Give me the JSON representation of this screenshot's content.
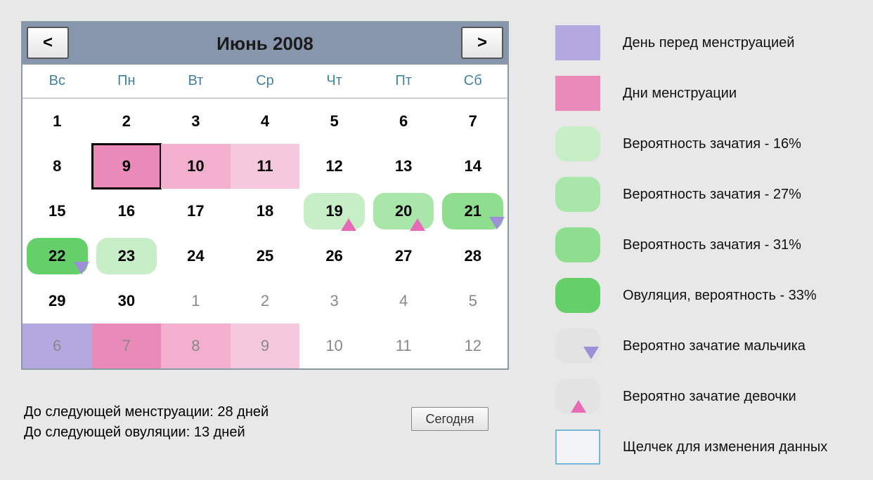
{
  "header": {
    "title": "Июнь 2008",
    "prev": "<",
    "next": ">"
  },
  "weekdays": [
    "Вс",
    "Пн",
    "Вт",
    "Ср",
    "Чт",
    "Пт",
    "Сб"
  ],
  "days": [
    {
      "n": "1"
    },
    {
      "n": "2"
    },
    {
      "n": "3"
    },
    {
      "n": "4"
    },
    {
      "n": "5"
    },
    {
      "n": "6"
    },
    {
      "n": "7"
    },
    {
      "n": "8"
    },
    {
      "n": "9",
      "bg": "men",
      "sel": true
    },
    {
      "n": "10",
      "bg": "men-light"
    },
    {
      "n": "11",
      "bg": "men-light2"
    },
    {
      "n": "12"
    },
    {
      "n": "13"
    },
    {
      "n": "14"
    },
    {
      "n": "15"
    },
    {
      "n": "16"
    },
    {
      "n": "17"
    },
    {
      "n": "18"
    },
    {
      "n": "19",
      "pill": "c16",
      "mark": "girl"
    },
    {
      "n": "20",
      "pill": "c27",
      "mark": "girl"
    },
    {
      "n": "21",
      "pill": "c31",
      "mark": "boy"
    },
    {
      "n": "22",
      "pill": "c33",
      "mark": "boy"
    },
    {
      "n": "23",
      "pill": "c16"
    },
    {
      "n": "24"
    },
    {
      "n": "25"
    },
    {
      "n": "26"
    },
    {
      "n": "27"
    },
    {
      "n": "28"
    },
    {
      "n": "29"
    },
    {
      "n": "30"
    },
    {
      "n": "1",
      "other": true
    },
    {
      "n": "2",
      "other": true
    },
    {
      "n": "3",
      "other": true
    },
    {
      "n": "4",
      "other": true
    },
    {
      "n": "5",
      "other": true
    },
    {
      "n": "6",
      "other": true,
      "bg": "pre"
    },
    {
      "n": "7",
      "other": true,
      "bg": "men"
    },
    {
      "n": "8",
      "other": true,
      "bg": "men-light"
    },
    {
      "n": "9",
      "other": true,
      "bg": "men-light2"
    },
    {
      "n": "10",
      "other": true
    },
    {
      "n": "11",
      "other": true
    },
    {
      "n": "12",
      "other": true
    }
  ],
  "footer": {
    "next_menstruation": "До следующей менструации: 28 дней",
    "next_ovulation": "До следующей овуляции: 13 дней",
    "today_btn": "Сегодня"
  },
  "legend": [
    {
      "type": "square",
      "color": "#B3A9E0",
      "label": "День перед менструацией"
    },
    {
      "type": "square",
      "color": "#E98AB8",
      "label": "Дни менструации"
    },
    {
      "type": "round",
      "color": "#C7EEC7",
      "label": "Вероятность зачатия - 16%"
    },
    {
      "type": "round",
      "color": "#A9E6A9",
      "label": "Вероятность зачатия - 27%"
    },
    {
      "type": "round",
      "color": "#8FDE8F",
      "label": "Вероятность зачатия - 31%"
    },
    {
      "type": "round",
      "color": "#65D06A",
      "label": "Овуляция, вероятность - 33%"
    },
    {
      "type": "round",
      "color": "#E3E3E3",
      "mark": "boy",
      "label": "Вероятно зачатие мальчика"
    },
    {
      "type": "round",
      "color": "#E3E3E3",
      "mark": "girl",
      "label": "Вероятно зачатие девочки"
    },
    {
      "type": "click",
      "label": "Щелчек для изменения данных"
    }
  ]
}
